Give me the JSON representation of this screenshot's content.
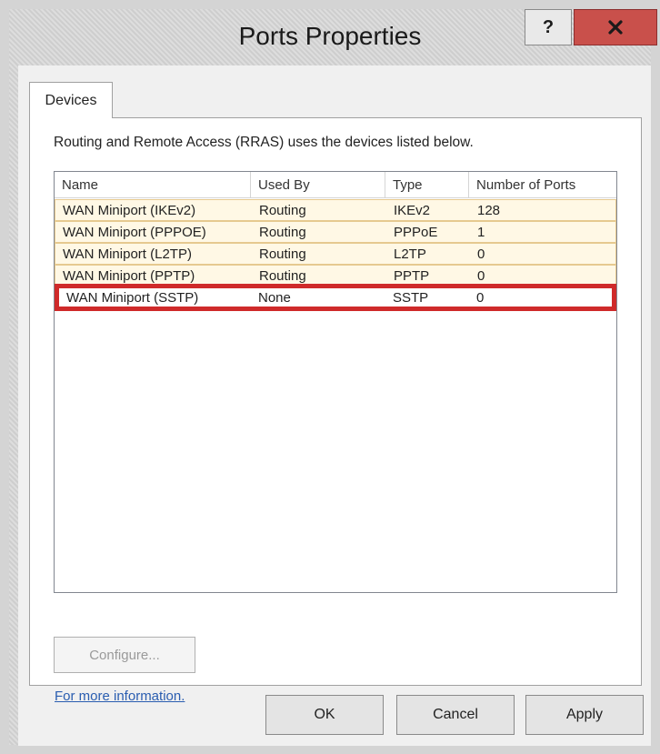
{
  "window": {
    "title": "Ports Properties",
    "help_label": "?",
    "close_icon": "close-icon"
  },
  "tabs": [
    {
      "label": "Devices"
    }
  ],
  "description": "Routing and Remote Access (RRAS) uses the devices listed below.",
  "table": {
    "columns": [
      "Name",
      "Used By",
      "Type",
      "Number of Ports"
    ],
    "rows": [
      {
        "name": "WAN Miniport (IKEv2)",
        "used_by": "Routing",
        "type": "IKEv2",
        "ports": "128"
      },
      {
        "name": "WAN Miniport (PPPOE)",
        "used_by": "Routing",
        "type": "PPPoE",
        "ports": "1"
      },
      {
        "name": "WAN Miniport (L2TP)",
        "used_by": "Routing",
        "type": "L2TP",
        "ports": "0"
      },
      {
        "name": "WAN Miniport (PPTP)",
        "used_by": "Routing",
        "type": "PPTP",
        "ports": "0"
      },
      {
        "name": "WAN Miniport (SSTP)",
        "used_by": "None",
        "type": "SSTP",
        "ports": "0"
      }
    ]
  },
  "configure_label": "Configure...",
  "more_info_link": "For more information.",
  "buttons": {
    "ok": "OK",
    "cancel": "Cancel",
    "apply": "Apply"
  },
  "colors": {
    "highlight_row": "#fff8e5",
    "selection_outline": "#cf2a2a",
    "close_button": "#c9504b"
  }
}
